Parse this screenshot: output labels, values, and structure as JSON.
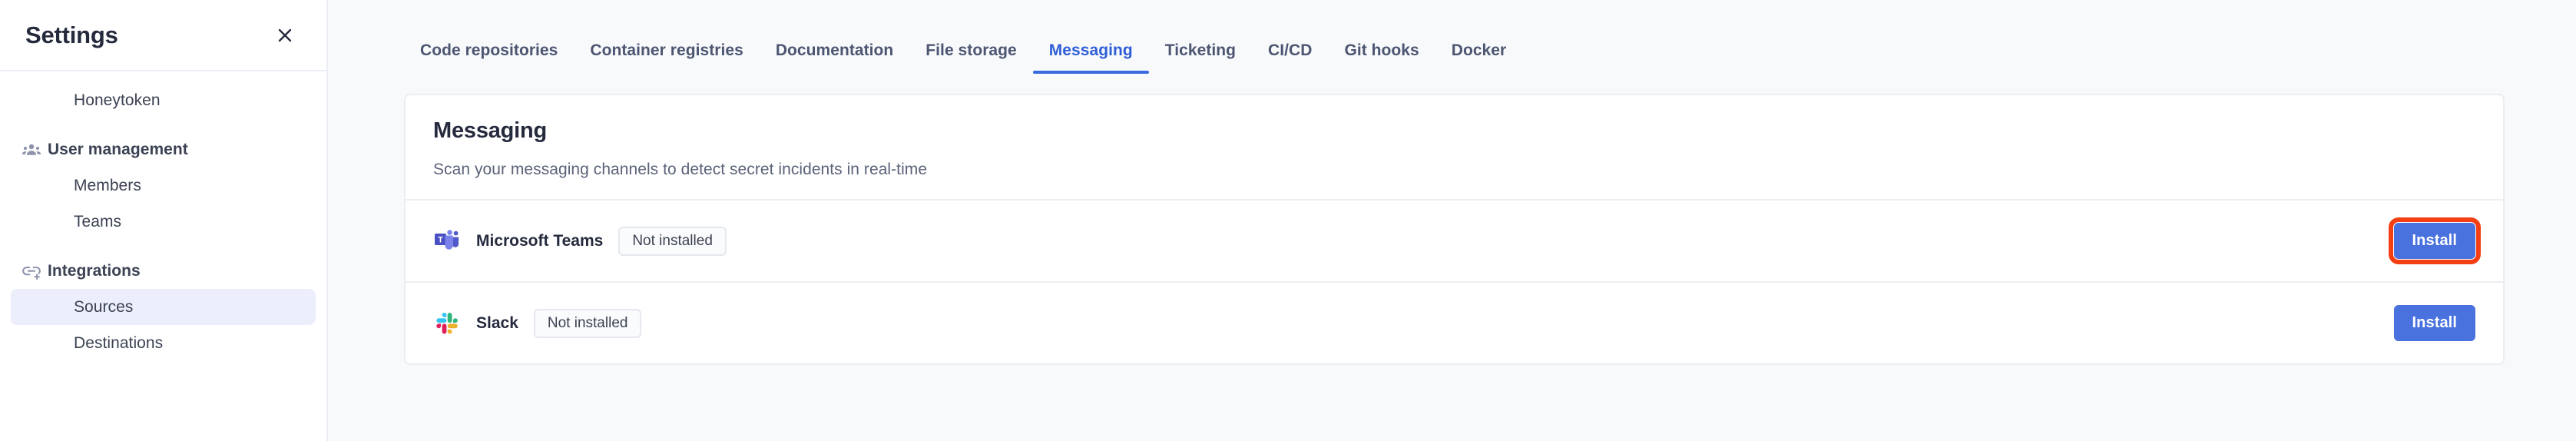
{
  "sidebar": {
    "title": "Settings",
    "close_icon": "close-icon",
    "items": [
      {
        "label": "Honeytoken",
        "icon": null,
        "type": "child",
        "active": false
      },
      {
        "label": "User management",
        "icon": "users-group-icon",
        "type": "section",
        "active": false
      },
      {
        "label": "Members",
        "icon": null,
        "type": "child",
        "active": false
      },
      {
        "label": "Teams",
        "icon": null,
        "type": "child",
        "active": false
      },
      {
        "label": "Integrations",
        "icon": "integrations-link-icon",
        "type": "section",
        "active": false
      },
      {
        "label": "Sources",
        "icon": null,
        "type": "child",
        "active": true
      },
      {
        "label": "Destinations",
        "icon": null,
        "type": "child",
        "active": false
      }
    ]
  },
  "tabs": [
    {
      "label": "Code repositories",
      "active": false
    },
    {
      "label": "Container registries",
      "active": false
    },
    {
      "label": "Documentation",
      "active": false
    },
    {
      "label": "File storage",
      "active": false
    },
    {
      "label": "Messaging",
      "active": true
    },
    {
      "label": "Ticketing",
      "active": false
    },
    {
      "label": "CI/CD",
      "active": false
    },
    {
      "label": "Git hooks",
      "active": false
    },
    {
      "label": "Docker",
      "active": false
    }
  ],
  "card": {
    "title": "Messaging",
    "subtitle": "Scan your messaging channels to detect secret incidents in real-time",
    "rows": [
      {
        "name": "Microsoft Teams",
        "logo": "microsoft-teams-logo-icon",
        "status": "Not installed",
        "action_label": "Install",
        "highlighted": true
      },
      {
        "name": "Slack",
        "logo": "slack-logo-icon",
        "status": "Not installed",
        "action_label": "Install",
        "highlighted": false
      }
    ]
  },
  "colors": {
    "accent_blue": "#4a72de",
    "tab_active": "#2f5fd8",
    "highlight_outline": "#f43f14",
    "sidebar_active_bg": "#eceefb",
    "text_dark": "#252a3d",
    "page_bg": "#f8f9fb"
  }
}
